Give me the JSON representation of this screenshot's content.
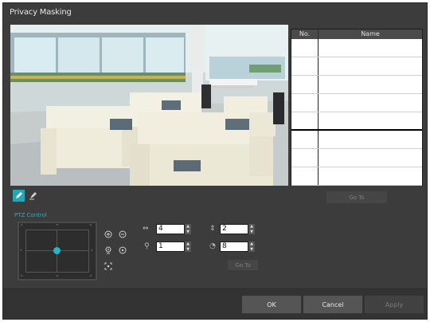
{
  "dialog": {
    "title": "Privacy Masking"
  },
  "table": {
    "headers": {
      "no": "No.",
      "name": "Name"
    },
    "rows": [
      {
        "no": "",
        "name": ""
      },
      {
        "no": "",
        "name": ""
      },
      {
        "no": "",
        "name": ""
      },
      {
        "no": "",
        "name": ""
      },
      {
        "no": "",
        "name": ""
      },
      {
        "no": "",
        "name": ""
      },
      {
        "no": "",
        "name": ""
      },
      {
        "no": "",
        "name": ""
      }
    ]
  },
  "toolbar": {
    "goto_label": "Go To",
    "icons": [
      "pencil-icon",
      "erase-icon"
    ]
  },
  "ptz": {
    "section_label": "PTZ Control",
    "fields": {
      "pan": "4",
      "zoom": "1",
      "tilt": "2",
      "focus": "8"
    },
    "goto_label": "Go To",
    "icons": [
      "focus-near-icon",
      "focus-far-icon",
      "zoom-in-icon",
      "zoom-out-icon",
      "auto-focus-icon"
    ]
  },
  "footer": {
    "ok_label": "OK",
    "cancel_label": "Cancel",
    "apply_label": "Apply"
  },
  "colors": {
    "accent": "#25a6b5",
    "dialog_bg": "#3c3c3c"
  }
}
